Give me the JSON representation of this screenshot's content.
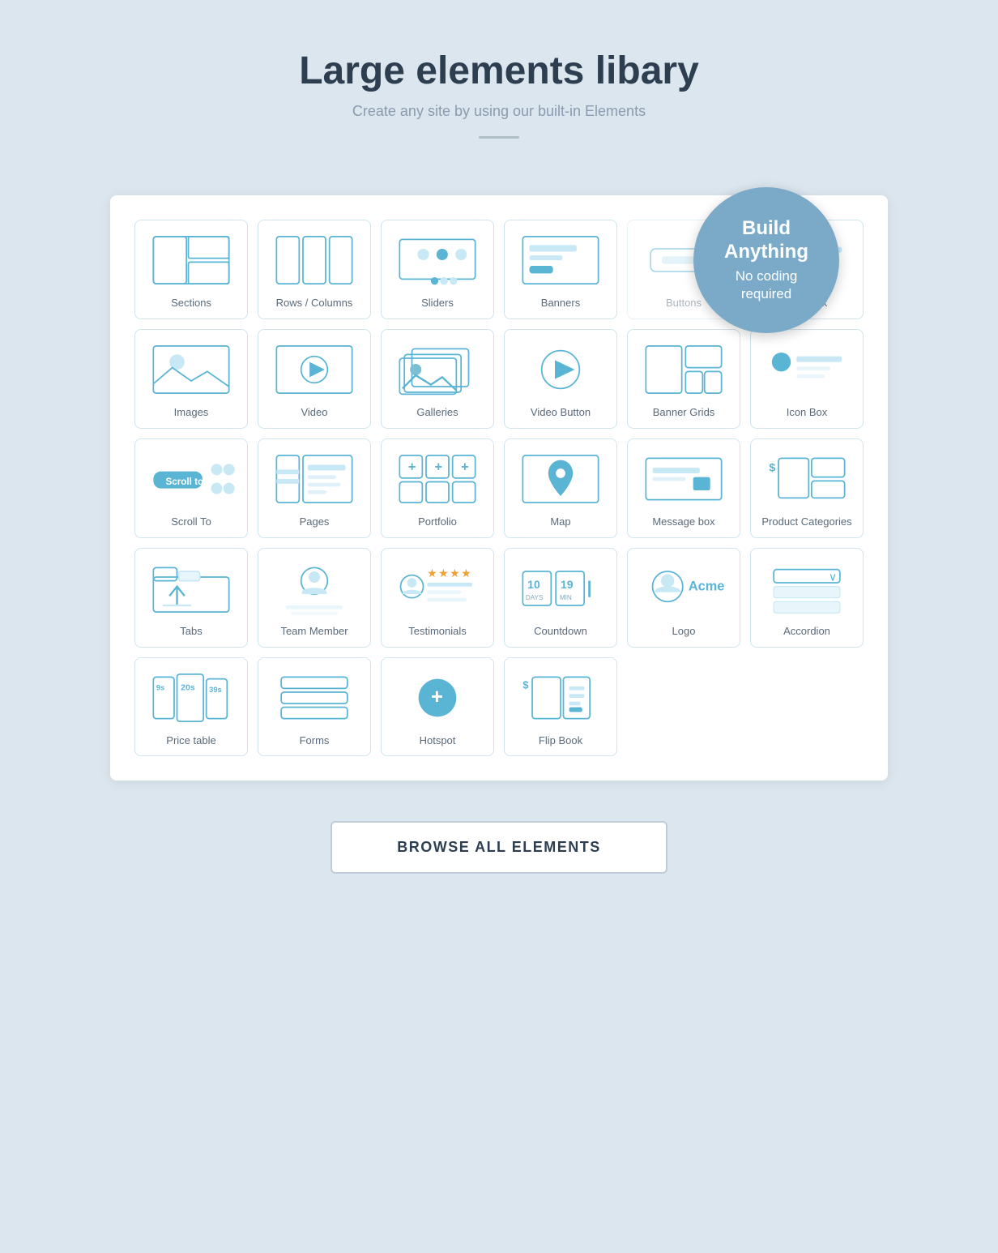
{
  "header": {
    "title": "Large elements libary",
    "subtitle": "Create any site by using our built-in Elements"
  },
  "badge": {
    "line1": "Build",
    "line2": "Anything",
    "line3": "No coding",
    "line4": "required"
  },
  "elements": [
    {
      "id": "sections",
      "label": "Sections"
    },
    {
      "id": "rows-columns",
      "label": "Rows / Columns"
    },
    {
      "id": "sliders",
      "label": "Sliders"
    },
    {
      "id": "banners",
      "label": "Banners"
    },
    {
      "id": "buttons",
      "label": "Buttons"
    },
    {
      "id": "icon-box",
      "label": "Icon Box"
    },
    {
      "id": "images",
      "label": "Images"
    },
    {
      "id": "video",
      "label": "Video"
    },
    {
      "id": "galleries",
      "label": "Galleries"
    },
    {
      "id": "video-button",
      "label": "Video Button"
    },
    {
      "id": "banner-grids",
      "label": "Banner Grids"
    },
    {
      "id": "icon-box-2",
      "label": "Icon Box"
    },
    {
      "id": "scroll-to",
      "label": "Scroll To"
    },
    {
      "id": "pages",
      "label": "Pages"
    },
    {
      "id": "portfolio",
      "label": "Portfolio"
    },
    {
      "id": "map",
      "label": "Map"
    },
    {
      "id": "message-box",
      "label": "Message box"
    },
    {
      "id": "product-categories",
      "label": "Product Categories"
    },
    {
      "id": "tabs",
      "label": "Tabs"
    },
    {
      "id": "team-member",
      "label": "Team Member"
    },
    {
      "id": "testimonials",
      "label": "Testimonials"
    },
    {
      "id": "countdown",
      "label": "Countdown"
    },
    {
      "id": "logo",
      "label": "Logo"
    },
    {
      "id": "accordion",
      "label": "Accordion"
    },
    {
      "id": "price-table",
      "label": "Price table"
    },
    {
      "id": "forms",
      "label": "Forms"
    },
    {
      "id": "hotspot",
      "label": "Hotspot"
    },
    {
      "id": "flip-book",
      "label": "Flip Book"
    }
  ],
  "browse_button": "BROWSE ALL ELEMENTS"
}
